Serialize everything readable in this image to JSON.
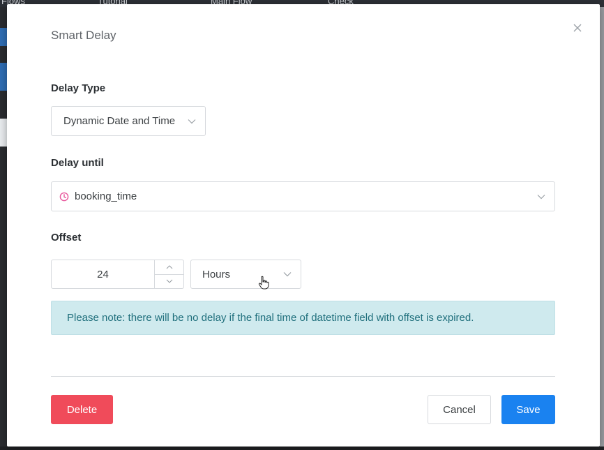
{
  "background": {
    "topbar_items": [
      "Flows",
      "Tutorial",
      "Main Flow",
      "Check"
    ]
  },
  "modal": {
    "title": "Smart Delay",
    "close_icon": "close-icon"
  },
  "delay_type": {
    "label": "Delay Type",
    "value": "Dynamic Date and Time"
  },
  "delay_until": {
    "label": "Delay until",
    "value": "booking_time",
    "icon": "clock-icon",
    "icon_color": "#e8579c"
  },
  "offset": {
    "label": "Offset",
    "amount": "24",
    "unit": "Hours"
  },
  "note": {
    "text": "Please note: there will be no delay if the final time of datetime field with offset is expired."
  },
  "buttons": {
    "delete": "Delete",
    "cancel": "Cancel",
    "save": "Save"
  },
  "colors": {
    "delete": "#f04b5a",
    "save": "#1a82f0",
    "note_bg": "#cfeaee",
    "note_text": "#1f6f7c"
  }
}
